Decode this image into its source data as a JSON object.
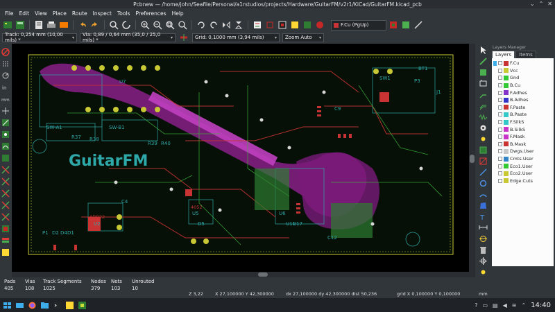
{
  "window": {
    "title": "Pcbnew — /home/john/Seafile/Personal/a1rstudios/projects/Hardware/GuitarFM/v2r1/KiCad/GuitarFM.kicad_pcb"
  },
  "menu": [
    "File",
    "Edit",
    "View",
    "Place",
    "Route",
    "Inspect",
    "Tools",
    "Preferences",
    "Help"
  ],
  "toolbar": {
    "layer_selector": "F.Cu (PgUp)",
    "track": "Track: 0,254 mm (10,00 mils) *",
    "via": "Via: 0,89 / 0,64 mm (35,0 / 25,0 mils) *",
    "grid": "Grid: 0,1000 mm (3,94 mils)",
    "zoom": "Zoom Auto"
  },
  "board": {
    "logo_text": "GuitarFM",
    "silk_labels": [
      "U7",
      "SW1",
      "BT1",
      "P3",
      "J1",
      "U2",
      "U5",
      "U6",
      "D5",
      "P1",
      "C4",
      "C9",
      "C12",
      "U11",
      "U17",
      "SW-A1",
      "SW-B1",
      "R37",
      "R38",
      "R39",
      "R40",
      "D2",
      "D4",
      "D1"
    ],
    "ic_labels": [
      "ADB22",
      "4052"
    ]
  },
  "layers_panel": {
    "title": "Layers Manager",
    "tabs": [
      "Layers",
      "Items"
    ],
    "layers": [
      {
        "name": "F.Cu",
        "color": "#c83434",
        "active": true
      },
      {
        "name": "Vcc",
        "color": "#c8c834"
      },
      {
        "name": "Gnd",
        "color": "#34c834"
      },
      {
        "name": "B.Cu",
        "color": "#34c834"
      },
      {
        "name": "F.Adhes",
        "color": "#8434c8"
      },
      {
        "name": "B.Adhes",
        "color": "#3434c8"
      },
      {
        "name": "F.Paste",
        "color": "#c83434"
      },
      {
        "name": "B.Paste",
        "color": "#34c8c8"
      },
      {
        "name": "F.SilkS",
        "color": "#34c8c8"
      },
      {
        "name": "B.SilkS",
        "color": "#c834c8"
      },
      {
        "name": "F.Mask",
        "color": "#c834c8"
      },
      {
        "name": "B.Mask",
        "color": "#c83434"
      },
      {
        "name": "Dwgs.User",
        "color": "#c8c8c8"
      },
      {
        "name": "Cmts.User",
        "color": "#3484c8"
      },
      {
        "name": "Eco1.User",
        "color": "#34c834"
      },
      {
        "name": "Eco2.User",
        "color": "#c8c834"
      },
      {
        "name": "Edge.Cuts",
        "color": "#c8c834"
      }
    ]
  },
  "stats": [
    {
      "label": "Pads",
      "value": "405"
    },
    {
      "label": "Vias",
      "value": "108"
    },
    {
      "label": "Track Segments",
      "value": "1025"
    },
    {
      "label": "Nodes",
      "value": "379"
    },
    {
      "label": "Nets",
      "value": "103"
    },
    {
      "label": "Unrouted",
      "value": "10"
    }
  ],
  "status": {
    "zoom": "Z 3,22",
    "xy": "X 27,100000  Y 42,300000",
    "delta": "dx 27,100000  dy 42,300000  dist 50,236",
    "grid": "grid X 0,100000  Y 0,100000",
    "units": "mm"
  },
  "taskbar": {
    "clock": "14:40"
  }
}
